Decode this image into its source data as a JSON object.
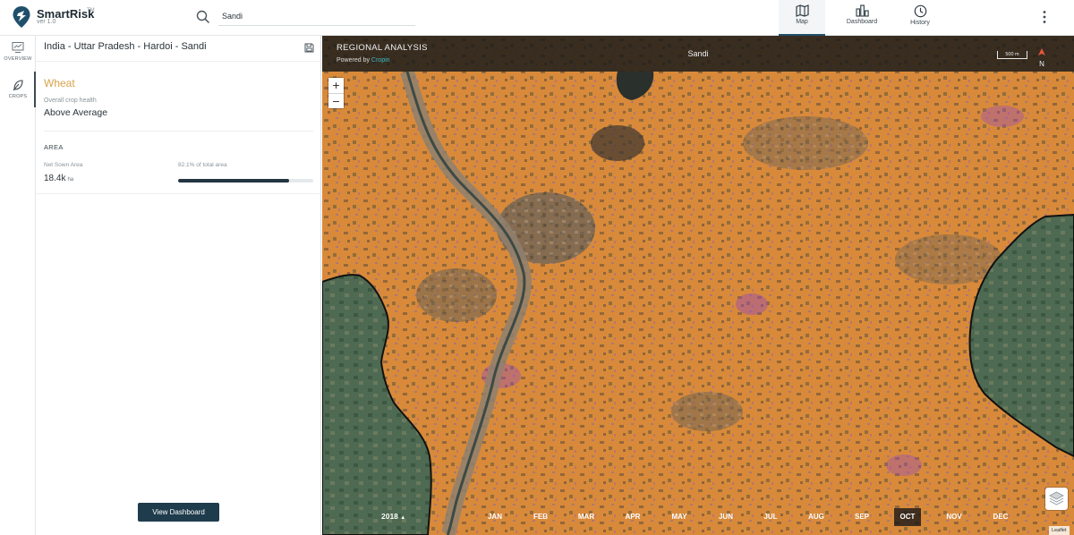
{
  "app": {
    "name": "SmartRisk",
    "trademark": "TM",
    "version": "ver 1.0"
  },
  "search": {
    "value": "Sandi"
  },
  "nav": {
    "tabs": [
      {
        "label": "Map",
        "icon": "map-icon",
        "active": true
      },
      {
        "label": "Dashboard",
        "icon": "dashboard-icon",
        "active": false
      },
      {
        "label": "History",
        "icon": "history-icon",
        "active": false
      }
    ]
  },
  "rail": {
    "items": [
      {
        "label": "OVERVIEW",
        "icon": "overview-icon",
        "active": false
      },
      {
        "label": "CROPS",
        "icon": "leaf-icon",
        "active": true
      }
    ]
  },
  "panel": {
    "breadcrumb": "India - Uttar Pradesh - Hardoi - Sandi",
    "crop": "Wheat",
    "health_label": "Overall crop health",
    "health_value": "Above Average",
    "area_title": "AREA",
    "net_sown_label": "Net Sown Area",
    "net_sown_value": "18.4k",
    "net_sown_unit": "ha",
    "pct_label": "82.1% of total area",
    "pct_value": 82.1,
    "view_button": "View Dashboard"
  },
  "map": {
    "title": "REGIONAL ANALYSIS",
    "powered_prefix": "Powered by ",
    "powered_brand": "Cropin",
    "region": "Sandi",
    "scale": "500 m",
    "north": "N",
    "zoom_in": "+",
    "zoom_out": "−",
    "year": "2018",
    "months": [
      "JAN",
      "FEB",
      "MAR",
      "APR",
      "MAY",
      "JUN",
      "JUL",
      "AUG",
      "SEP",
      "OCT",
      "NOV",
      "DEC"
    ],
    "active_month": "OCT",
    "attribution": "Leaflet"
  },
  "colors": {
    "crop_overlay": "#d98a3c",
    "accent_dark": "#1f3c4c",
    "crop_title": "#d9a24a",
    "brand": "#39b8c8"
  }
}
